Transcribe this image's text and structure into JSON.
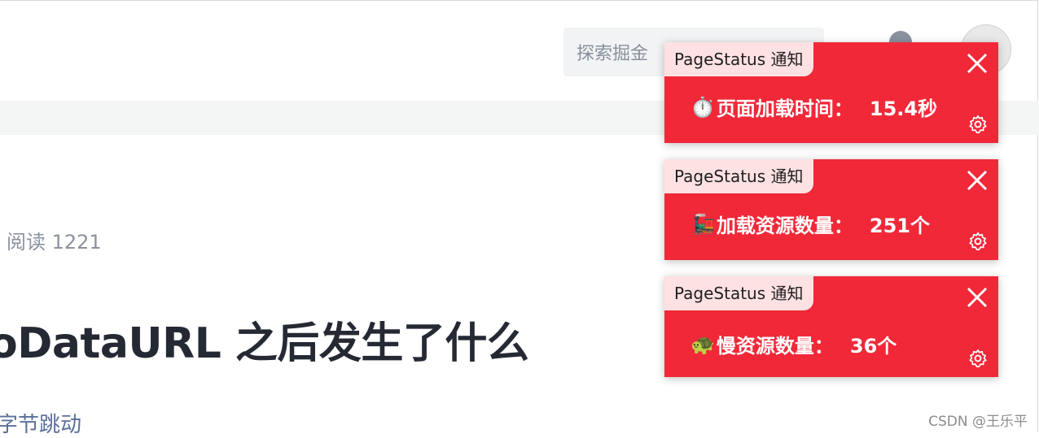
{
  "header": {
    "search_placeholder": "探索掘金"
  },
  "article": {
    "meta": "阅读 1221",
    "title": "oDataURL 之后发生了什么",
    "author_fragment": "字节跳动"
  },
  "notifications": [
    {
      "tag": "PageStatus 通知",
      "emoji": "⏱️",
      "label": "页面加载时间：",
      "value": "15.4秒"
    },
    {
      "tag": "PageStatus 通知",
      "emoji": "🚂",
      "label": "加载资源数量：",
      "value": "251个"
    },
    {
      "tag": "PageStatus 通知",
      "emoji": "🐢",
      "label": "慢资源数量：",
      "value": "36个"
    }
  ],
  "watermark": "CSDN @王乐平",
  "colors": {
    "notification_bg": "#f02838",
    "notification_tag_bg": "#fde1e3"
  },
  "icons": {
    "close": "close-icon",
    "settings": "gear-icon",
    "notifications": "bell-icon"
  }
}
